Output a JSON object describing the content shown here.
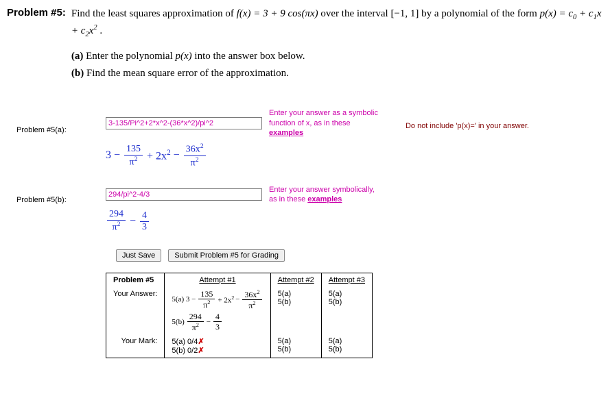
{
  "problem": {
    "label": "Problem #5:",
    "statement_pre": "Find the least squares approximation of ",
    "f_expr": "f(x) = 3 + 9 cos(πx)",
    "statement_mid": " over the interval ",
    "interval": "[−1, 1]",
    "statement_post": " by a polynomial of the form ",
    "p_form_label": "p(x) = c",
    "p_form_rest": " + c",
    "p_form_rest2": "x + c",
    "p_form_rest3": "x",
    "period": ".",
    "sub0": "0",
    "sub1": "1",
    "sub2": "2",
    "sup2": "2",
    "part_a_label": "(a)",
    "part_a_text": " Enter the polynomial ",
    "part_a_px": "p(x)",
    "part_a_text2": " into the answer box below.",
    "part_b_label": "(b)",
    "part_b_text": " Find the mean square error of the approximation."
  },
  "answer_a": {
    "row_label": "Problem #5(a):",
    "input_value": "3-135/Pi^2+2*x^2-(36*x^2)/pi^2",
    "hint_line1": "Enter your answer as a symbolic",
    "hint_line2": "function of x, as in these",
    "hint_link": "examples",
    "note": "Do not include 'p(x)=' in your answer.",
    "echo": {
      "lead": "3 − ",
      "f1_num": "135",
      "f1_den": "π",
      "plus": " + 2x",
      "minus": " − ",
      "f2_num": "36x",
      "f2_den": "π"
    }
  },
  "answer_b": {
    "row_label": "Problem #5(b):",
    "input_value": "294/pi^2-4/3",
    "hint_line1": "Enter your answer symbolically,",
    "hint_line2": "as in these ",
    "hint_link": "examples",
    "echo": {
      "f1_num": "294",
      "f1_den": "π",
      "minus": " − ",
      "f2_num": "4",
      "f2_den": "3"
    }
  },
  "buttons": {
    "save": "Just Save",
    "submit": "Submit Problem #5 for Grading"
  },
  "table": {
    "header_problem": "Problem #5",
    "attempt1": "Attempt #1",
    "attempt2": "Attempt #2",
    "attempt3": "Attempt #3",
    "your_answer": "Your Answer:",
    "your_mark": "Your Mark:",
    "ans_a_prefix": "5(a) 3 − ",
    "ans_a_f1num": "135",
    "ans_a_f1den": "π",
    "ans_a_mid": " + 2x",
    "ans_a_minus": " − ",
    "ans_a_f2num": "36x",
    "ans_a_f2den": "π",
    "ans_b_prefix": "5(b) ",
    "ans_b_f1num": "294",
    "ans_b_f1den": "π",
    "ans_b_minus": " − ",
    "ans_b_f2num": "4",
    "ans_b_f2den": "3",
    "cell_5a": "5(a)",
    "cell_5b": "5(b)",
    "mark_a": "5(a) 0/4",
    "mark_b": "5(b) 0/2",
    "x": "✗"
  },
  "sup2": "2"
}
